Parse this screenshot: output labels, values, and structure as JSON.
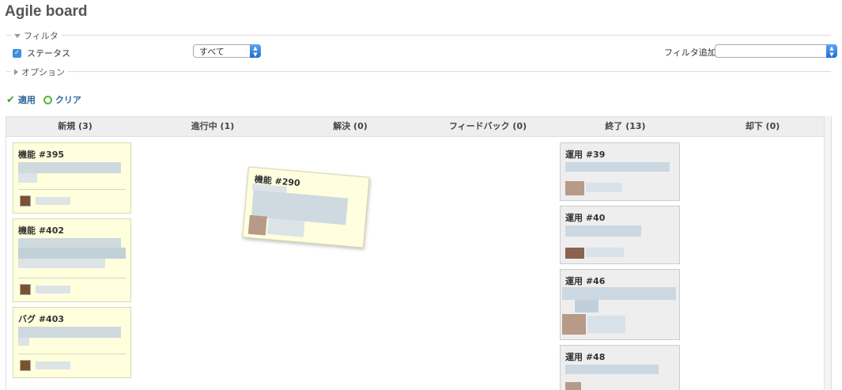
{
  "page": {
    "title": "Agile board"
  },
  "filters": {
    "legend": "フィルタ",
    "status_label": "ステータス",
    "status_value": "すべて",
    "add_filter_label": "フィルタ追加",
    "add_filter_value": ""
  },
  "options": {
    "legend": "オプション"
  },
  "actions": {
    "apply": "適用",
    "clear": "クリア"
  },
  "columns": [
    {
      "label": "新規 (3)"
    },
    {
      "label": "進行中 (1)"
    },
    {
      "label": "解決 (0)"
    },
    {
      "label": "フィードバック (0)"
    },
    {
      "label": "終了 (13)"
    },
    {
      "label": "却下 (0)"
    }
  ],
  "cards": {
    "new": [
      {
        "title": "機能 #395"
      },
      {
        "title": "機能 #402"
      },
      {
        "title": "バグ #403"
      }
    ],
    "dragging": {
      "title": "機能 #290"
    },
    "closed": [
      {
        "title": "運用 #39"
      },
      {
        "title": "運用 #40"
      },
      {
        "title": "運用 #46"
      },
      {
        "title": "運用 #48"
      }
    ]
  },
  "colors": {
    "card_yellow": "#ffffdd",
    "card_gray": "#eeeeee",
    "link": "#2a6496",
    "accent_check": "#4aa02c"
  }
}
